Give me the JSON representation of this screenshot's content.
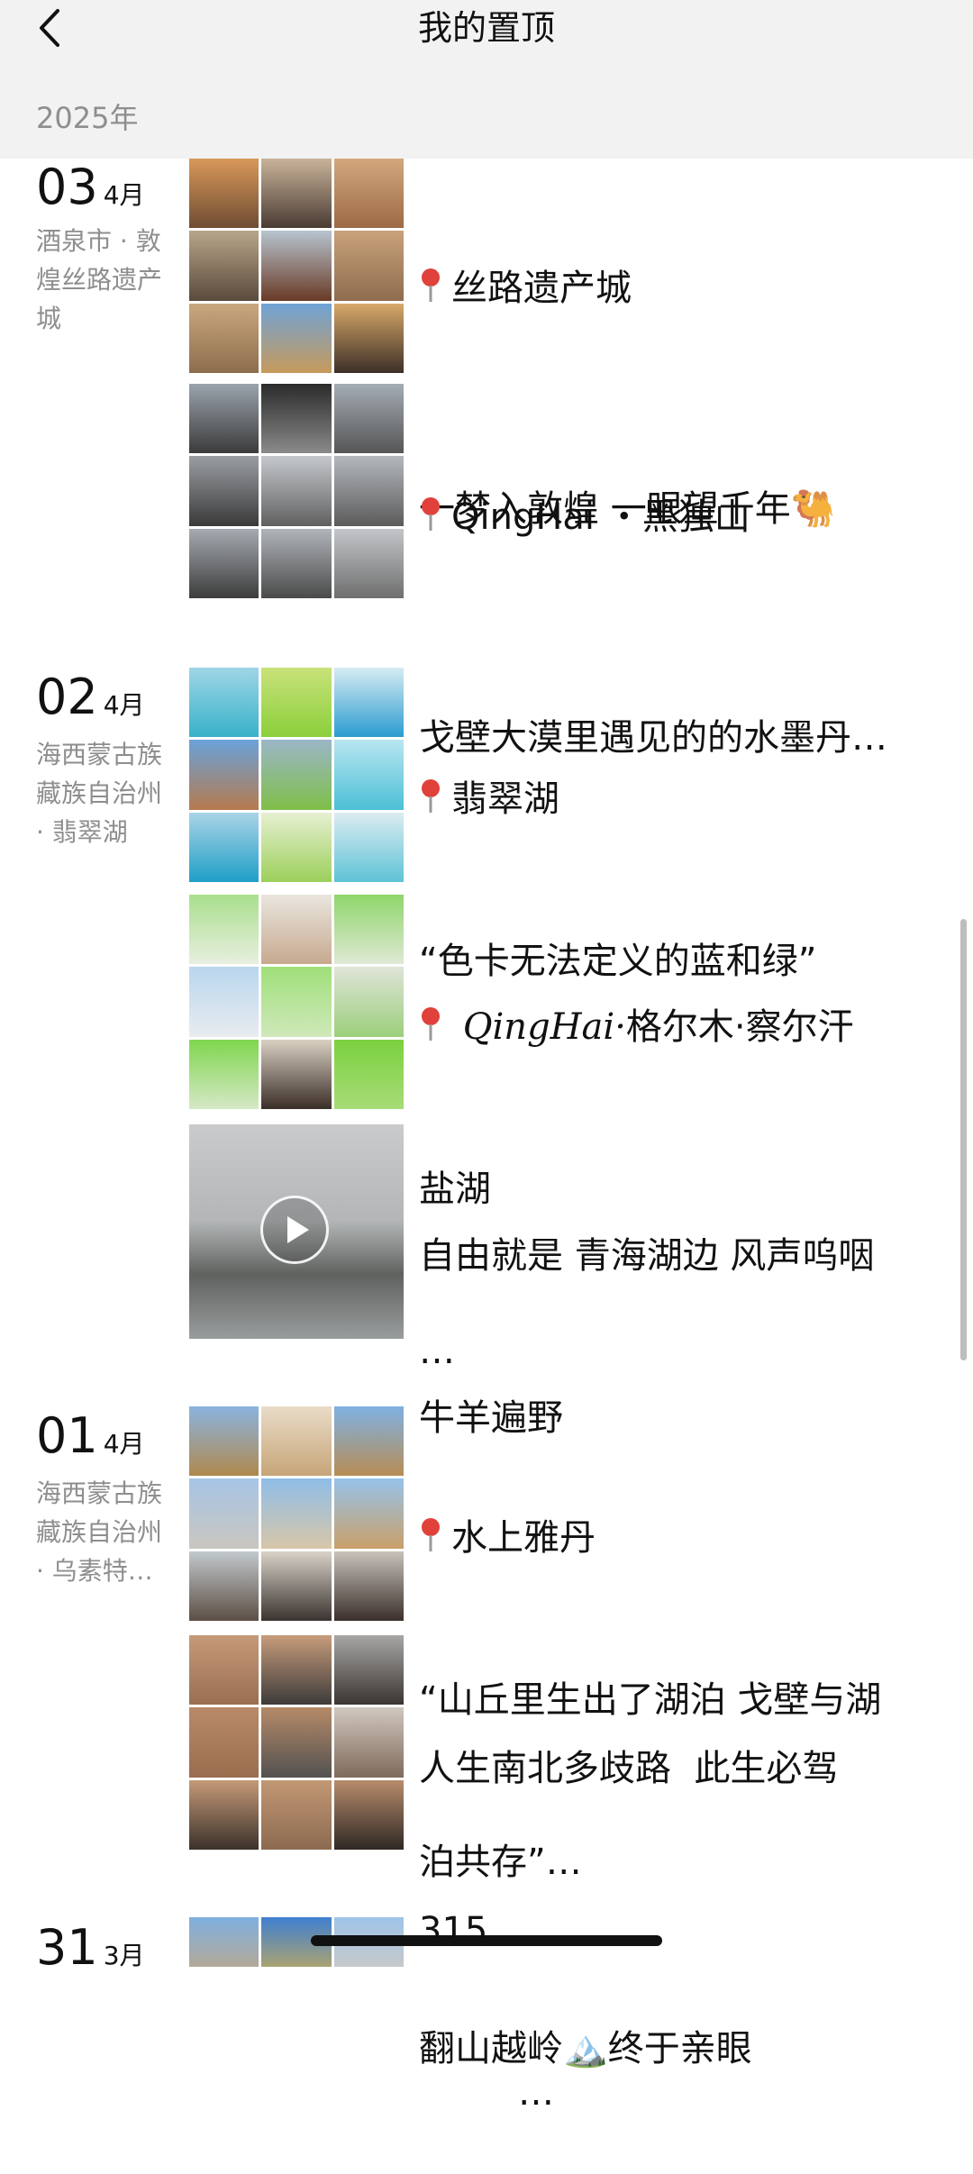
{
  "header": {
    "title": "我的置顶"
  },
  "year_label": "2025年",
  "groups": [
    {
      "day": "03",
      "month": "4月",
      "location": "酒泉市 · 敦煌丝路遗产城",
      "posts": [
        {
          "kind": "grid",
          "line1": "丝路遗产城",
          "line2": "一梦入敦煌 一眼望千年🐫"
        },
        {
          "kind": "grid",
          "line1": "QingHai ・黑独山",
          "line2": "戈壁大漠里遇见的的水墨丹…"
        }
      ]
    },
    {
      "day": "02",
      "month": "4月",
      "location": "海西蒙古族藏族自治州 · 翡翠湖",
      "posts": [
        {
          "kind": "grid",
          "line1": "翡翠湖",
          "line2": "“色卡无法定义的蓝和绿”"
        },
        {
          "kind": "grid",
          "line1_italic": "QingHai·",
          "line1": "格尔木·察尔汗",
          "line2": "盐湖",
          "line3": "…"
        },
        {
          "kind": "video",
          "line1": "自由就是 青海湖边 风声呜咽",
          "line2": "牛羊遍野"
        }
      ]
    },
    {
      "day": "01",
      "month": "4月",
      "location": "海西蒙古族藏族自治州 · 乌素特…",
      "posts": [
        {
          "kind": "grid",
          "line1": "水上雅丹",
          "line2": "“山丘里生出了湖泊 戈壁与湖",
          "line3": "泊共存”…"
        },
        {
          "kind": "grid",
          "line1": "人生南北多歧路  此生必驾",
          "line2": "315",
          "line3": "…"
        }
      ]
    },
    {
      "day": "31",
      "month": "3月",
      "location": "",
      "posts": [
        {
          "kind": "grid",
          "line1": "翻山越岭🏔️终于亲眼"
        }
      ]
    }
  ],
  "colors": {
    "nav_bg": "#f2f2f2",
    "secondary_text": "#8e8e8e",
    "pin": "#e0413a"
  }
}
